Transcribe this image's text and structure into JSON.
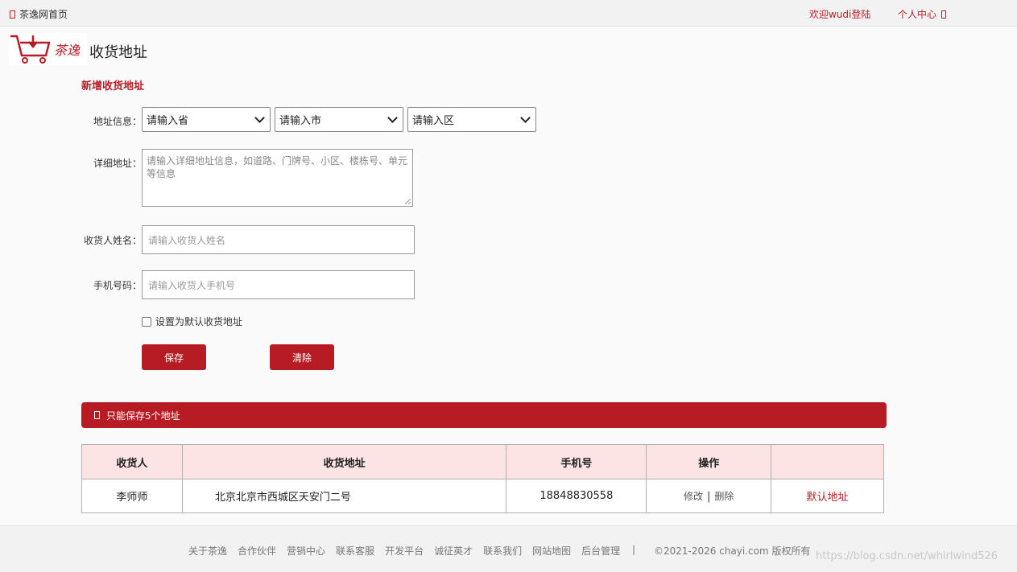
{
  "topbar": {
    "home_label": "茶逸网首页",
    "welcome": "欢迎wudi登陆",
    "user_center": "个人中心"
  },
  "header": {
    "logo_text": "茶逸",
    "title": "收货地址"
  },
  "form": {
    "title": "新增收货地址",
    "address_label": "地址信息：",
    "province": "请输入省",
    "city": "请输入市",
    "district": "请输入区",
    "detail_label": "详细地址：",
    "detail_placeholder": "请输入详细地址信息，如道路、门牌号、小区、楼栋号、单元等信息",
    "name_label": "收货人姓名：",
    "name_placeholder": "请输入收货人姓名",
    "phone_label": "手机号码：",
    "phone_placeholder": "请输入收货人手机号",
    "default_checkbox": "设置为默认收货地址",
    "save_label": "保存",
    "clear_label": "清除"
  },
  "notice": "只能保存5个地址",
  "table": {
    "headers": [
      "收货人",
      "收货地址",
      "手机号",
      "操作",
      ""
    ],
    "rows": [
      {
        "name": "李师师",
        "address": "北京北京市西城区天安门二号",
        "phone": "18848830558",
        "edit": "修改",
        "delete": "删除",
        "default": "默认地址"
      }
    ]
  },
  "footer": {
    "links": [
      "关于茶逸",
      "合作伙伴",
      "营销中心",
      "联系客服",
      "开发平台",
      "诚征英才",
      "联系我们",
      "网站地图",
      "后台管理"
    ],
    "separator": "|",
    "copyright": "©2021-2026 chayi.com 版权所有",
    "watermark": "https://blog.csdn.net/whirlwind526"
  },
  "colors": {
    "brand": "#b71c24",
    "header_bg": "#fce4e4"
  }
}
